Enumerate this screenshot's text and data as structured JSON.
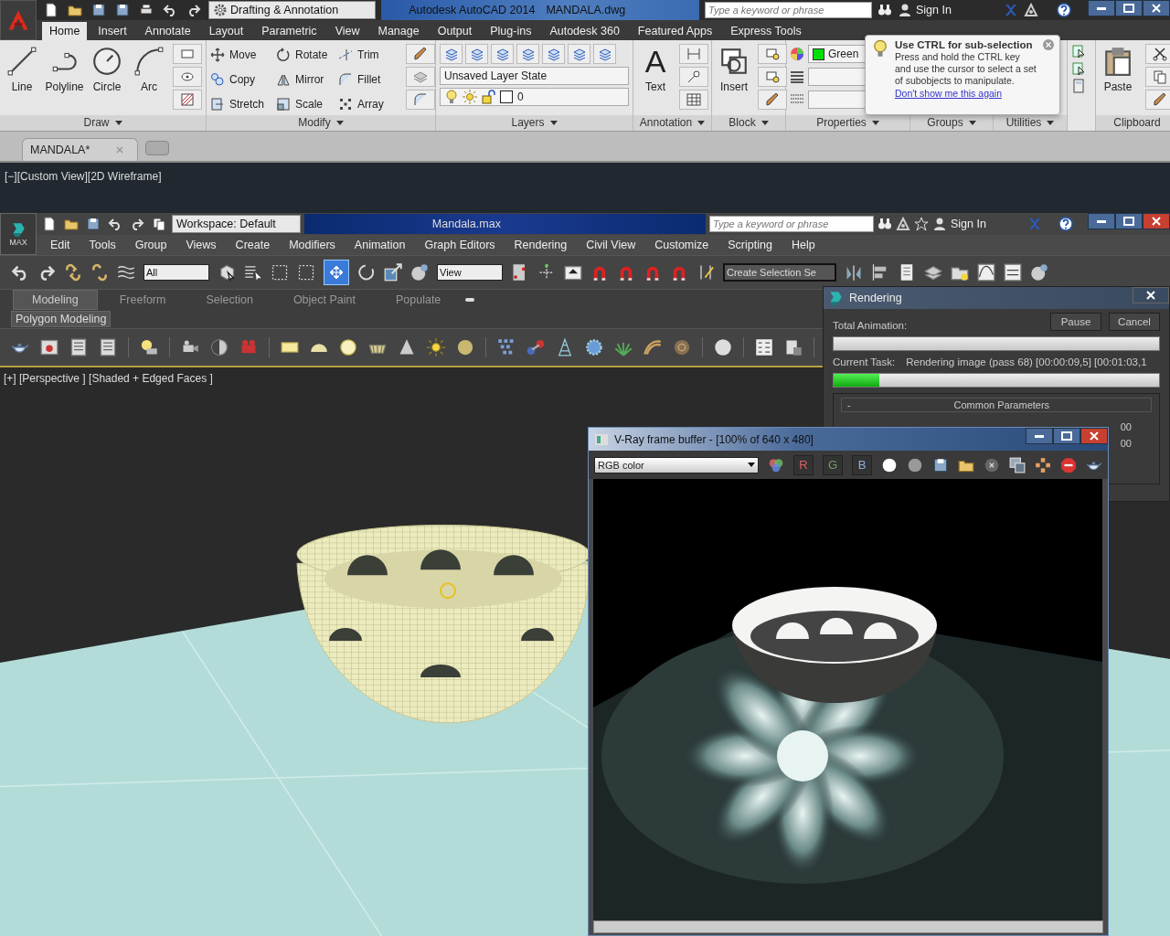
{
  "autocad": {
    "workspace": "Drafting & Annotation",
    "title": "Autodesk AutoCAD 2014",
    "file_name": "MANDALA.dwg",
    "search": {
      "placeholder": "Type a keyword or phrase"
    },
    "sign_in": "Sign In",
    "tabs": [
      {
        "label": "Home",
        "selected": true
      },
      {
        "label": "Insert",
        "selected": false
      },
      {
        "label": "Annotate",
        "selected": false
      },
      {
        "label": "Layout",
        "selected": false
      },
      {
        "label": "Parametric",
        "selected": false
      },
      {
        "label": "View",
        "selected": false
      },
      {
        "label": "Manage",
        "selected": false
      },
      {
        "label": "Output",
        "selected": false
      },
      {
        "label": "Plug-ins",
        "selected": false
      },
      {
        "label": "Autodesk 360",
        "selected": false
      },
      {
        "label": "Featured Apps",
        "selected": false
      },
      {
        "label": "Express Tools",
        "selected": false
      }
    ],
    "panels": {
      "draw": {
        "title": "Draw",
        "tools": [
          "Line",
          "Polyline",
          "Circle",
          "Arc"
        ]
      },
      "modify": {
        "title": "Modify",
        "tools": [
          "Move",
          "Rotate",
          "Trim",
          "Copy",
          "Mirror",
          "Fillet",
          "Stretch",
          "Scale",
          "Array"
        ]
      },
      "layers": {
        "title": "Layers",
        "layer_state": "Unsaved Layer State",
        "current_layer": "0"
      },
      "annotation": {
        "title": "Annotation",
        "glyph": "A",
        "tool": "Text"
      },
      "block": {
        "title": "Block",
        "tool": "Insert"
      },
      "properties": {
        "title": "Properties",
        "color_setting": "Green"
      },
      "groups": {
        "title": "Groups"
      },
      "utilities": {
        "title": "Utilities"
      },
      "clipboard": {
        "title": "Clipboard",
        "tool": "Paste"
      }
    },
    "document_tab": "MANDALA*",
    "viewport_label": "[−][Custom View][2D Wireframe]"
  },
  "tooltip": {
    "title": "Use CTRL for sub-selection",
    "body": "Press and hold the CTRL key and use the cursor to select a set of subobjects to manipulate.",
    "link": "Don't show me this again"
  },
  "max": {
    "logo": "MAX",
    "workspace": "Workspace: Default",
    "title": "Mandala.max",
    "search": {
      "placeholder": "Type a keyword or phrase"
    },
    "sign_in": "Sign In",
    "menu": [
      "Edit",
      "Tools",
      "Group",
      "Views",
      "Create",
      "Modifiers",
      "Animation",
      "Graph Editors",
      "Rendering",
      "Civil View",
      "Customize",
      "Scripting",
      "Help"
    ],
    "toolbar": {
      "selection_filter": "All",
      "reference_coordinates": "View",
      "named_selection": "Create Selection Se"
    },
    "ribbon_tabs": [
      {
        "label": "Modeling",
        "selected": true
      },
      {
        "label": "Freeform",
        "selected": false
      },
      {
        "label": "Selection",
        "selected": false
      },
      {
        "label": "Object Paint",
        "selected": false
      },
      {
        "label": "Populate",
        "selected": false
      }
    ],
    "ribbon_panel": "Polygon Modeling",
    "viewport_label": "[+] [Perspective ] [Shaded + Edged Faces ]"
  },
  "rendering_dialog": {
    "title": "Rendering",
    "total_label": "Total Animation:",
    "buttons": [
      "Pause",
      "Cancel"
    ],
    "task_label": "Current Task:",
    "task": "Rendering image (pass 68) [00:00:09,5] [00:01:03,1",
    "current": {
      "level": 0.14
    },
    "rollout": {
      "toggle": "-",
      "title": "Common Parameters",
      "values": [
        "00",
        "00"
      ]
    }
  },
  "frame_buffer": {
    "title": "V-Ray frame buffer - [100% of 640 x 480]",
    "channel": "RGB color",
    "channel_buttons": [
      {
        "label": "R",
        "color": "#e06060"
      },
      {
        "label": "G",
        "color": "#70a060"
      },
      {
        "label": "B",
        "color": "#8fb0d8"
      }
    ]
  }
}
